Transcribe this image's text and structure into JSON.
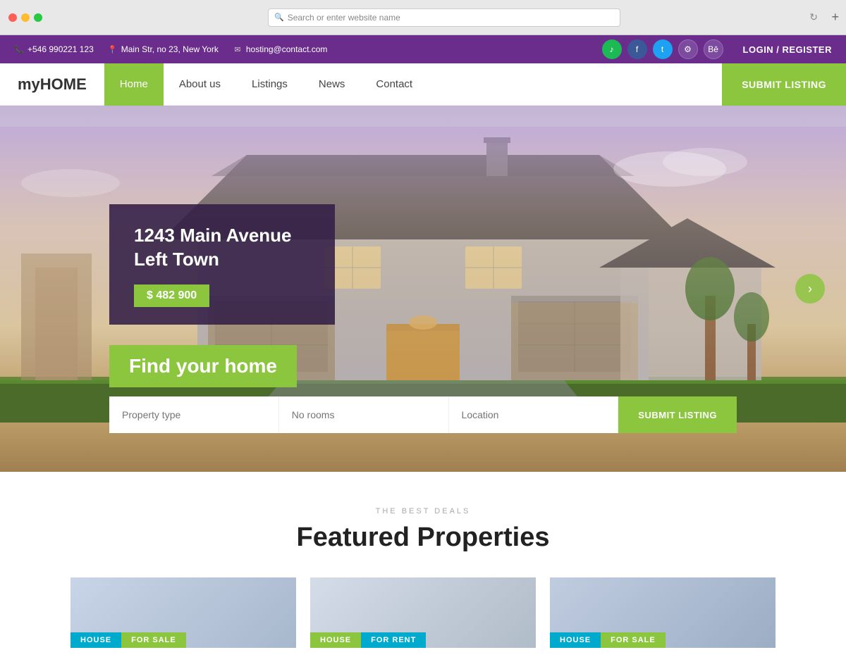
{
  "browser": {
    "address_placeholder": "Search or enter website name",
    "add_tab": "+"
  },
  "topbar": {
    "phone": "+546 990221 123",
    "address": "Main Str, no 23, New York",
    "email": "hosting@contact.com",
    "login_label": "LOGIN / REGISTER",
    "social": [
      "♪",
      "f",
      "t",
      "⚙",
      "Be"
    ]
  },
  "navbar": {
    "brand_prefix": "my",
    "brand_suffix": "HOME",
    "links": [
      "Home",
      "About us",
      "Listings",
      "News",
      "Contact"
    ],
    "submit_label": "SUBMIT LISTING"
  },
  "hero": {
    "property_title": "1243 Main Avenue Left Town",
    "property_price": "$ 482 900",
    "find_home_text": "Find your home",
    "search": {
      "property_type_placeholder": "Property type",
      "rooms_placeholder": "No rooms",
      "location_placeholder": "Location",
      "submit_label": "SUBMIT LISTING"
    },
    "arrow_label": "›"
  },
  "featured": {
    "subtitle": "THE BEST DEALS",
    "title": "Featured Properties",
    "cards": [
      {
        "badge1": "HOUSE",
        "badge2": "FOR SALE",
        "badge1_color": "#00aacc",
        "badge2_color": "#8cc63f"
      },
      {
        "badge1": "HOUSE",
        "badge2": "FOR RENT",
        "badge1_color": "#8cc63f",
        "badge2_color": "#00aacc"
      },
      {
        "badge1": "HOUSE",
        "badge2": "FOR SALE",
        "badge1_color": "#00aacc",
        "badge2_color": "#8cc63f"
      }
    ]
  }
}
